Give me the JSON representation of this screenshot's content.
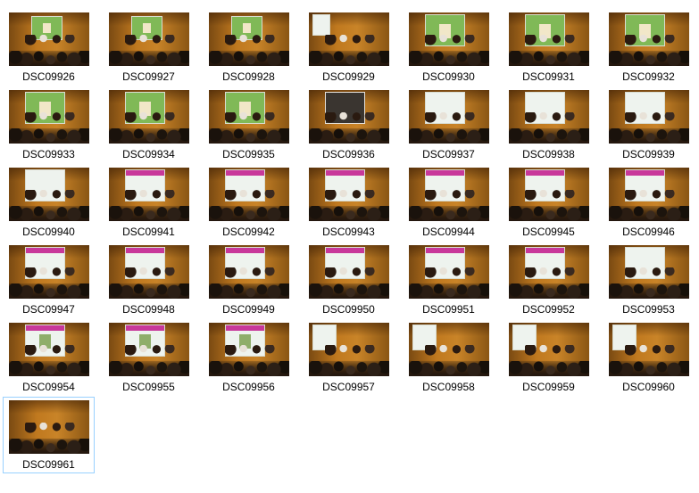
{
  "view": "large-icons",
  "selected_file": "DSC09961",
  "files": [
    {
      "name": "DSC09926",
      "screen": "green-landscape"
    },
    {
      "name": "DSC09927",
      "screen": "green-landscape"
    },
    {
      "name": "DSC09928",
      "screen": "green-landscape"
    },
    {
      "name": "DSC09929",
      "screen": "white"
    },
    {
      "name": "DSC09930",
      "screen": "green-photo"
    },
    {
      "name": "DSC09931",
      "screen": "green-photo"
    },
    {
      "name": "DSC09932",
      "screen": "green-photo"
    },
    {
      "name": "DSC09933",
      "screen": "green-photo"
    },
    {
      "name": "DSC09934",
      "screen": "green-photo"
    },
    {
      "name": "DSC09935",
      "screen": "green-photo"
    },
    {
      "name": "DSC09936",
      "screen": "dark-slide"
    },
    {
      "name": "DSC09937",
      "screen": "white-slide"
    },
    {
      "name": "DSC09938",
      "screen": "white-slide"
    },
    {
      "name": "DSC09939",
      "screen": "white-slide"
    },
    {
      "name": "DSC09940",
      "screen": "white-slide"
    },
    {
      "name": "DSC09941",
      "screen": "pink-header-slide"
    },
    {
      "name": "DSC09942",
      "screen": "pink-header-slide"
    },
    {
      "name": "DSC09943",
      "screen": "pink-header-slide"
    },
    {
      "name": "DSC09944",
      "screen": "pink-header-slide"
    },
    {
      "name": "DSC09945",
      "screen": "pink-header-slide"
    },
    {
      "name": "DSC09946",
      "screen": "pink-header-slide"
    },
    {
      "name": "DSC09947",
      "screen": "pink-header-slide"
    },
    {
      "name": "DSC09948",
      "screen": "pink-header-slide"
    },
    {
      "name": "DSC09949",
      "screen": "pink-header-slide"
    },
    {
      "name": "DSC09950",
      "screen": "pink-header-slide"
    },
    {
      "name": "DSC09951",
      "screen": "pink-header-slide"
    },
    {
      "name": "DSC09952",
      "screen": "pink-header-slide"
    },
    {
      "name": "DSC09953",
      "screen": "white-slide"
    },
    {
      "name": "DSC09954",
      "screen": "pink-photo-slide"
    },
    {
      "name": "DSC09955",
      "screen": "pink-photo-slide"
    },
    {
      "name": "DSC09956",
      "screen": "pink-photo-slide"
    },
    {
      "name": "DSC09957",
      "screen": "panel-wide"
    },
    {
      "name": "DSC09958",
      "screen": "panel-wide"
    },
    {
      "name": "DSC09959",
      "screen": "panel-wide"
    },
    {
      "name": "DSC09960",
      "screen": "panel-wide"
    },
    {
      "name": "DSC09961",
      "screen": "none"
    }
  ],
  "colors": {
    "wall": "#c0791f",
    "screen": "#eef3ee",
    "slide_header_pink": "#c8389a",
    "slide_band_green": "#6cae3c",
    "selection_border": "#99d1ff",
    "label_text": "#000000"
  }
}
